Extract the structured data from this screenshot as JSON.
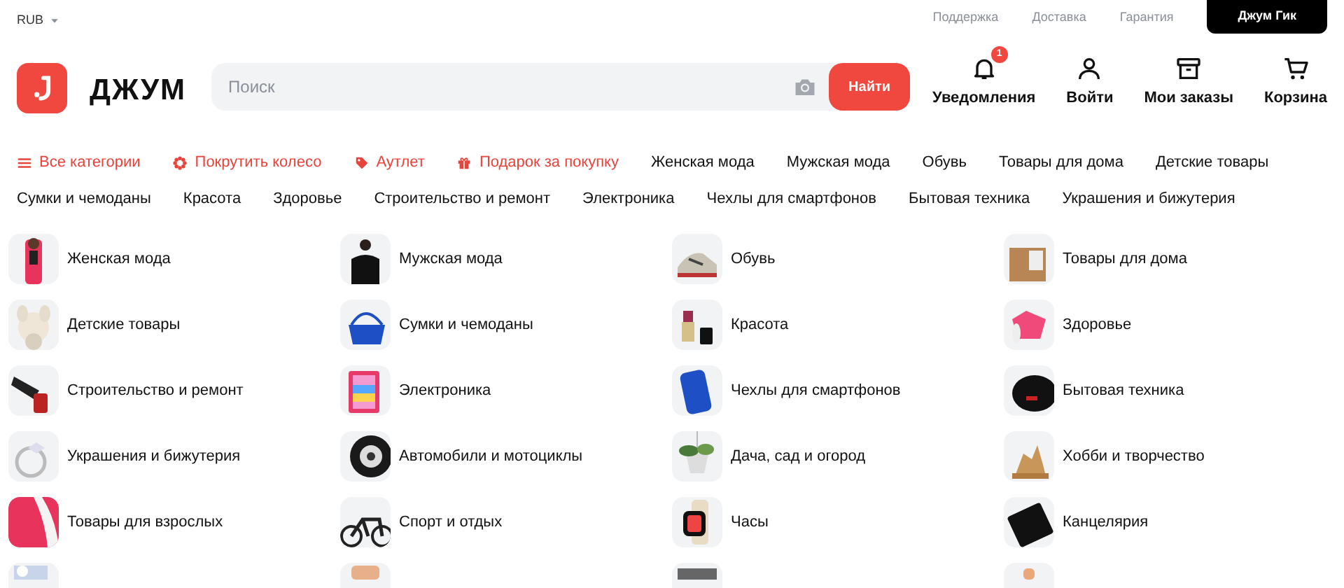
{
  "topbar": {
    "currency": "RUB",
    "links": [
      "Поддержка",
      "Доставка",
      "Гарантия"
    ],
    "button": "Джум Гик"
  },
  "header": {
    "logo": "ДЖУМ",
    "search": {
      "placeholder": "Поиск",
      "button": "Найти"
    },
    "actions": [
      {
        "label": "Уведомления",
        "badge": "1"
      },
      {
        "label": "Войти"
      },
      {
        "label": "Мои заказы"
      },
      {
        "label": "Корзина"
      }
    ]
  },
  "nav_rows": [
    [
      {
        "label": "Все категории",
        "kind": "promo"
      },
      {
        "label": "Покрутить колесо",
        "kind": "promo"
      },
      {
        "label": "Аутлет",
        "kind": "promo"
      },
      {
        "label": "Подарок за покупку",
        "kind": "promo"
      },
      {
        "label": "Женская мода",
        "kind": "category"
      },
      {
        "label": "Мужская мода",
        "kind": "category"
      },
      {
        "label": "Обувь",
        "kind": "category"
      },
      {
        "label": "Товары для дома",
        "kind": "category"
      },
      {
        "label": "Детские товары",
        "kind": "category"
      }
    ],
    [
      {
        "label": "Сумки и чемоданы",
        "kind": "category"
      },
      {
        "label": "Красота",
        "kind": "category"
      },
      {
        "label": "Здоровье",
        "kind": "category"
      },
      {
        "label": "Строительство и ремонт",
        "kind": "category"
      },
      {
        "label": "Электроника",
        "kind": "category"
      },
      {
        "label": "Чехлы для смартфонов",
        "kind": "category"
      },
      {
        "label": "Бытовая техника",
        "kind": "category"
      },
      {
        "label": "Украшения и бижутерия",
        "kind": "category"
      }
    ]
  ],
  "categories": [
    {
      "label": "Женская мода"
    },
    {
      "label": "Мужская мода"
    },
    {
      "label": "Обувь"
    },
    {
      "label": "Товары для дома"
    },
    {
      "label": "Детские товары"
    },
    {
      "label": "Сумки и чемоданы"
    },
    {
      "label": "Красота"
    },
    {
      "label": "Здоровье"
    },
    {
      "label": "Строительство и ремонт"
    },
    {
      "label": "Электроника"
    },
    {
      "label": "Чехлы для смартфонов"
    },
    {
      "label": "Бытовая техника"
    },
    {
      "label": "Украшения и бижутерия"
    },
    {
      "label": "Автомобили и мотоциклы"
    },
    {
      "label": "Дача, сад и огород"
    },
    {
      "label": "Хобби и творчество"
    },
    {
      "label": "Товары для взрослых"
    },
    {
      "label": "Спорт и отдых"
    },
    {
      "label": "Часы"
    },
    {
      "label": "Канцелярия"
    },
    {
      "kind": "picture"
    },
    {
      "kind": "picture"
    },
    {
      "kind": "picture"
    },
    {
      "kind": "picture"
    }
  ]
}
